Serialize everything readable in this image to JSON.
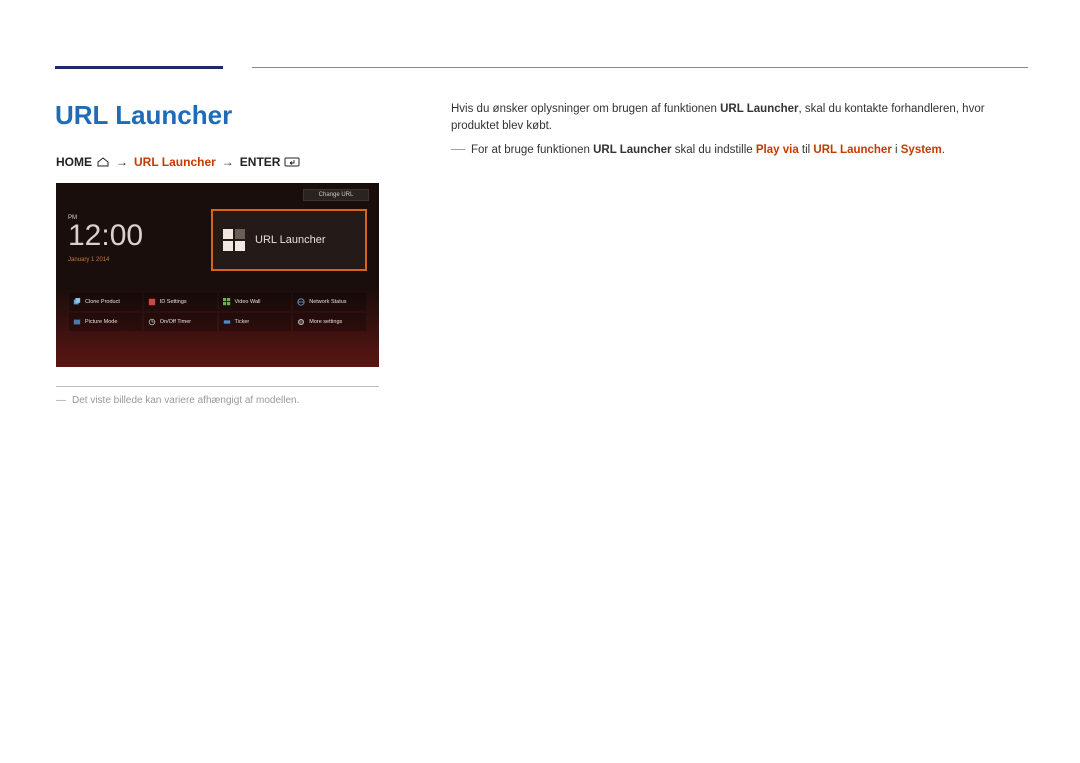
{
  "title": "URL Launcher",
  "breadcrumb": {
    "home": "HOME",
    "arrow": "→",
    "url_launcher": "URL Launcher",
    "enter": "ENTER"
  },
  "screenshot": {
    "change_url": "Change URL",
    "clock": {
      "pm": "PM",
      "time": "12:00",
      "date": "January 1  2014"
    },
    "tile_label": "URL Launcher",
    "grid": {
      "items": [
        {
          "label": "Clone Product"
        },
        {
          "label": "ID Settings"
        },
        {
          "label": "Video Wall"
        },
        {
          "label": "Network Status"
        },
        {
          "label": "Picture Mode"
        },
        {
          "label": "On/Off Timer"
        },
        {
          "label": "Ticker"
        },
        {
          "label": "More settings"
        }
      ]
    }
  },
  "caption": "Det viste billede kan variere afhængigt af modellen.",
  "body": {
    "p1_pre": "Hvis du ønsker oplysninger om brugen af funktionen ",
    "p1_bold": "URL Launcher",
    "p1_post": ", skal du kontakte forhandleren, hvor produktet blev købt.",
    "p2_pre": "For at bruge funktionen ",
    "p2_b1": "URL Launcher",
    "p2_mid1": " skal du indstille ",
    "p2_a1": "Play via",
    "p2_mid2": " til ",
    "p2_a2": "URL Launcher",
    "p2_mid3": " i ",
    "p2_a3": "System",
    "p2_post": "."
  }
}
